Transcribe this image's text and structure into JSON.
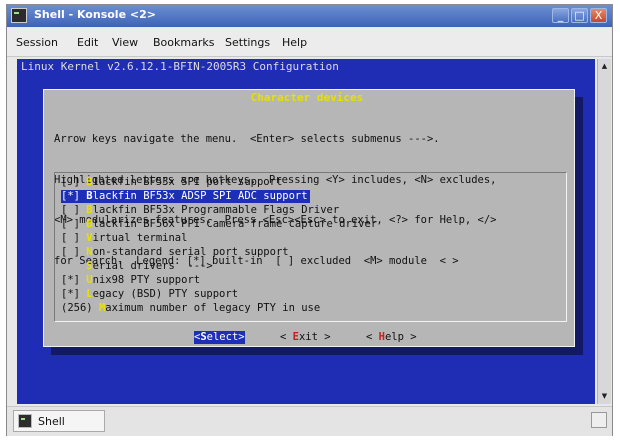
{
  "window": {
    "title": "Shell - Konsole <2>",
    "buttons": {
      "minimize": "_",
      "maximize": "□",
      "close": "X"
    }
  },
  "menubar": {
    "items": [
      "Session",
      "Edit",
      "View",
      "Bookmarks",
      "Settings",
      "Help"
    ]
  },
  "terminal": {
    "header": "Linux Kernel v2.6.12.1-BFIN-2005R3 Configuration",
    "dialog": {
      "title": " Character devices ",
      "help_lines": [
        "Arrow keys navigate the menu.  <Enter> selects submenus --->.",
        "Highlighted letters are hotkeys.  Pressing <Y> includes, <N> excludes,",
        "<M> modularizes features.  Press <Esc><Esc> to exit, <?> for Help, </>",
        "for Search.  Legend: [*] built-in  [ ] excluded  <M> module  < >"
      ],
      "items": [
        {
          "prefix": "[ ] ",
          "hot": "B",
          "rest": "lackfin BF53x SPI port support",
          "selected": false
        },
        {
          "prefix": "[*] ",
          "hot": "B",
          "rest": "lackfin BF53x ADSP SPI ADC support",
          "selected": true
        },
        {
          "prefix": "[ ] ",
          "hot": "B",
          "rest": "lackfin BF53x Programmable Flags Driver",
          "selected": false
        },
        {
          "prefix": "[ ] ",
          "hot": "B",
          "rest": "lackfin BF56x PPI Camera frame capture driver",
          "selected": false
        },
        {
          "prefix": "[ ] ",
          "hot": "V",
          "rest": "irtual terminal",
          "selected": false
        },
        {
          "prefix": "[ ] ",
          "hot": "N",
          "rest": "on-standard serial port support",
          "selected": false
        },
        {
          "prefix": "    ",
          "hot": "S",
          "rest": "erial drivers  --->",
          "selected": false
        },
        {
          "prefix": "[*] ",
          "hot": "U",
          "rest": "nix98 PTY support",
          "selected": false
        },
        {
          "prefix": "[*] ",
          "hot": "L",
          "rest": "egacy (BSD) PTY support",
          "selected": false
        },
        {
          "prefix": "(256) ",
          "hot": "M",
          "rest": "aximum number of legacy PTY in use",
          "selected": false
        }
      ],
      "buttons": [
        {
          "pre": "<",
          "hot": "S",
          "rest": "elect>",
          "active": true
        },
        {
          "pre": "< ",
          "hot": "E",
          "rest": "xit >",
          "active": false
        },
        {
          "pre": "< ",
          "hot": "H",
          "rest": "elp >",
          "active": false
        }
      ]
    }
  },
  "scrollbar": {
    "up": "▲",
    "down": "▼"
  },
  "tabbar": {
    "tabs": [
      {
        "label": "Shell"
      }
    ]
  }
}
